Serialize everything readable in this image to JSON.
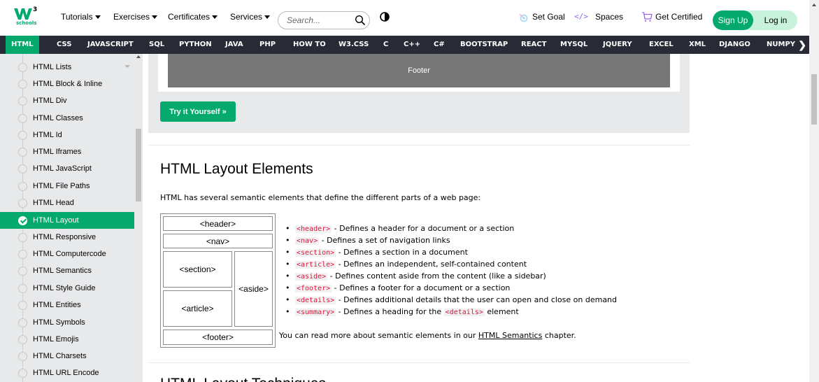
{
  "topbar": {
    "logo_text": "schools",
    "nav": [
      {
        "label": "Tutorials",
        "has_caret": true
      },
      {
        "label": "Exercises",
        "has_caret": true
      },
      {
        "label": "Certificates",
        "has_caret": true
      },
      {
        "label": "Services",
        "has_caret": true
      }
    ],
    "search_placeholder": "Search...",
    "set_goal": "Set Goal",
    "spaces": "Spaces",
    "get_certified": "Get Certified",
    "sign_up": "Sign Up",
    "log_in": "Log in",
    "icons": [
      "search-icon",
      "theme-toggle-icon",
      "goal-icon",
      "spaces-code-icon",
      "cart-icon"
    ]
  },
  "darknav": {
    "items": [
      "HTML",
      "CSS",
      "JAVASCRIPT",
      "SQL",
      "PYTHON",
      "JAVA",
      "PHP",
      "HOW TO",
      "W3.CSS",
      "C",
      "C++",
      "C#",
      "BOOTSTRAP",
      "REACT",
      "MYSQL",
      "JQUERY",
      "EXCEL",
      "XML",
      "DJANGO",
      "NUMPY"
    ],
    "active": "HTML",
    "more_arrow": "❯"
  },
  "sidebar": {
    "items": [
      "HTML Lists",
      "HTML Block & Inline",
      "HTML Div",
      "HTML Classes",
      "HTML Id",
      "HTML Iframes",
      "HTML JavaScript",
      "HTML File Paths",
      "HTML Head",
      "HTML Layout",
      "HTML Responsive",
      "HTML Computercode",
      "HTML Semantics",
      "HTML Style Guide",
      "HTML Entities",
      "HTML Symbols",
      "HTML Emojis",
      "HTML Charsets",
      "HTML URL Encode"
    ],
    "active": "HTML Layout"
  },
  "example": {
    "footer_demo": "Footer",
    "try_button": "Try it Yourself »"
  },
  "section": {
    "heading": "HTML Layout Elements",
    "intro": "HTML has several semantic elements that define the different parts of a web page:",
    "diagram": {
      "header": "<header>",
      "nav": "<nav>",
      "section": "<section>",
      "article": "<article>",
      "aside": "<aside>",
      "footer": "<footer>"
    },
    "bullets": [
      {
        "tag": "<header>",
        "text": " - Defines a header for a document or a section"
      },
      {
        "tag": "<nav>",
        "text": " - Defines a set of navigation links"
      },
      {
        "tag": "<section>",
        "text": " - Defines a section in a document"
      },
      {
        "tag": "<article>",
        "text": " - Defines an independent, self-contained content"
      },
      {
        "tag": "<aside>",
        "text": " - Defines content aside from the content (like a sidebar)"
      },
      {
        "tag": "<footer>",
        "text": " - Defines a footer for a document or a section"
      },
      {
        "tag": "<details>",
        "text": " - Defines additional details that the user can open and close on demand"
      },
      {
        "tag": "<summary>",
        "text": " - Defines a heading for the ",
        "tag2": "<details>",
        "text2": " element"
      }
    ],
    "readmore_prefix": "You can read more about semantic elements in our ",
    "readmore_link": "HTML Semantics",
    "readmore_suffix": " chapter.",
    "next_heading": "HTML Layout Techniques"
  },
  "colors": {
    "brand_green": "#04AA6D",
    "dark_nav": "#282A35",
    "sidebar_bg": "#e7e9eb",
    "code_red": "#dc143c"
  }
}
